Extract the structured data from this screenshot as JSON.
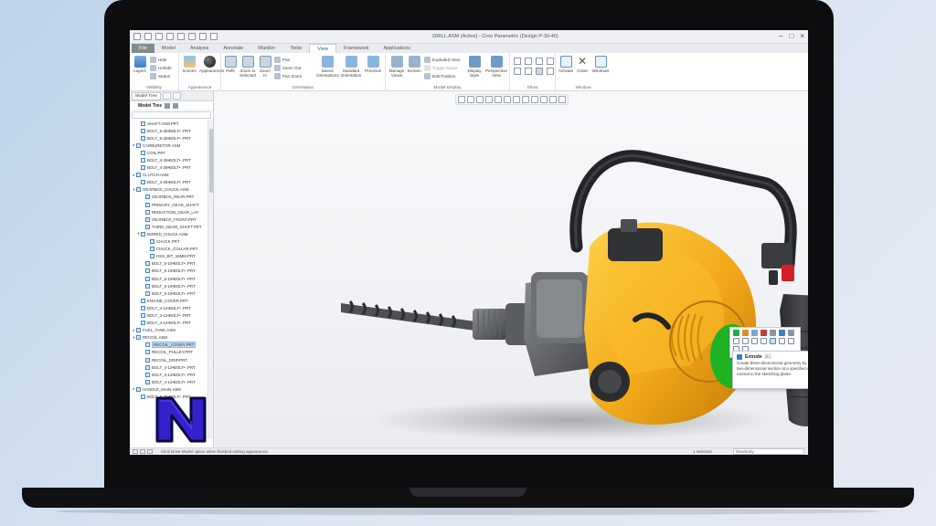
{
  "window": {
    "title": "DRILL.ASM (Active) - Creo Parametric (Design P-30-40)"
  },
  "tabs": [
    {
      "label": "File",
      "active": false
    },
    {
      "label": "Model",
      "active": false
    },
    {
      "label": "Analysis",
      "active": false
    },
    {
      "label": "Annotate",
      "active": false
    },
    {
      "label": "Manikin",
      "active": false
    },
    {
      "label": "Tools",
      "active": false
    },
    {
      "label": "View",
      "active": true
    },
    {
      "label": "Framework",
      "active": false
    },
    {
      "label": "Applications",
      "active": false
    }
  ],
  "ribbon": {
    "groups": [
      "Visibility",
      "Appearance",
      "Orientation",
      "Model Display",
      "Show",
      "Window"
    ],
    "buttons": {
      "layers": "Layers",
      "hide": "Hide",
      "unhide": "Unhide",
      "status": "Status",
      "scenes": "Scenes",
      "appearances": "Appearances",
      "refit": "Refit",
      "zoom_to_selected": "Zoom to Selected",
      "zoom_in": "Zoom In",
      "zoom_out": "Zoom Out",
      "pan": "Pan",
      "pan_zoom": "Pan Zoom",
      "saved_orientations": "Saved Orientations",
      "standard_orientation": "Standard Orientation",
      "previous": "Previous",
      "manage_views": "Manage Views",
      "section": "Section",
      "exploded_view": "Exploded View",
      "toggle_status": "Toggle Status",
      "edit_position": "Edit Position",
      "display_style": "Display Style",
      "perspective_view": "Perspective View",
      "activate": "Activate",
      "close": "Close",
      "windows": "Windows"
    }
  },
  "panel": {
    "tab_model_tree": "Model Tree",
    "header": "Model Tree"
  },
  "tree": [
    {
      "indent": 1,
      "expander": "",
      "label": "SHAFT.ASM.PRT",
      "selected": false
    },
    {
      "indent": 1,
      "expander": "",
      "label": "BOLT_5-30•BOLT• .PRT",
      "selected": false
    },
    {
      "indent": 1,
      "expander": "",
      "label": "BOLT_5-30•BOLT• .PRT",
      "selected": false
    },
    {
      "indent": 0,
      "expander": "▸",
      "label": "CARBURETOR.ASM",
      "selected": false
    },
    {
      "indent": 1,
      "expander": "",
      "label": "COIL.PRT",
      "selected": false
    },
    {
      "indent": 1,
      "expander": "",
      "label": "BOLT_4-30•BOLT• .PRT",
      "selected": false
    },
    {
      "indent": 1,
      "expander": "",
      "label": "BOLT_4-30•BOLT• .PRT",
      "selected": false
    },
    {
      "indent": 0,
      "expander": "▸",
      "label": "CLUTCH.ASM",
      "selected": false
    },
    {
      "indent": 1,
      "expander": "",
      "label": "BOLT_4-30•BOLT• .PRT",
      "selected": false
    },
    {
      "indent": 0,
      "expander": "▾",
      "label": "GEARBOX_CHUCK.ASM",
      "selected": false
    },
    {
      "indent": 2,
      "expander": "",
      "label": "GEARBOX_REAR.PRT",
      "selected": false
    },
    {
      "indent": 2,
      "expander": "",
      "label": "PRIMARY_GEAR_SHAFT",
      "selected": false
    },
    {
      "indent": 2,
      "expander": "",
      "label": "REDUCTION_GEAR_LAY",
      "selected": false
    },
    {
      "indent": 2,
      "expander": "",
      "label": "GEARBOX_FRONT.PRT",
      "selected": false
    },
    {
      "indent": 2,
      "expander": "",
      "label": "THIRD_GEAR_SHAFT.PRT",
      "selected": false
    },
    {
      "indent": 1,
      "expander": "▾",
      "label": "BORED_CHUCK.ASM",
      "selected": false
    },
    {
      "indent": 3,
      "expander": "",
      "label": "CHUCK.PRT",
      "selected": false
    },
    {
      "indent": 3,
      "expander": "",
      "label": "CHUCK_COLLAR.PRT",
      "selected": false
    },
    {
      "indent": 3,
      "expander": "",
      "label": "HSS_BIT_16MM.PRT",
      "selected": false
    },
    {
      "indent": 2,
      "expander": "",
      "label": "BOLT_5-10•BOLT• .PRT",
      "selected": false
    },
    {
      "indent": 2,
      "expander": "",
      "label": "BOLT_5-10•BOLT• .PRT",
      "selected": false
    },
    {
      "indent": 2,
      "expander": "",
      "label": "BOLT_5-10•BOLT• .PRT",
      "selected": false
    },
    {
      "indent": 2,
      "expander": "",
      "label": "BOLT_5-10•BOLT• .PRT",
      "selected": false
    },
    {
      "indent": 2,
      "expander": "",
      "label": "BOLT_5-10•BOLT• .PRT",
      "selected": false
    },
    {
      "indent": 1,
      "expander": "",
      "label": "ENGINE_COVER.PRT",
      "selected": false
    },
    {
      "indent": 1,
      "expander": "",
      "label": "BOLT_4-12•BOLT• .PRT",
      "selected": false
    },
    {
      "indent": 1,
      "expander": "",
      "label": "BOLT_4-12•BOLT• .PRT",
      "selected": false
    },
    {
      "indent": 1,
      "expander": "",
      "label": "BOLT_4-12•BOLT• .PRT",
      "selected": false
    },
    {
      "indent": 0,
      "expander": "▸",
      "label": "FUEL_TANK.ASM",
      "selected": false
    },
    {
      "indent": 0,
      "expander": "▾",
      "label": "RECOIL.ASM",
      "selected": false
    },
    {
      "indent": 2,
      "expander": "",
      "label": "RECOIL_COVER.PRT",
      "selected": true
    },
    {
      "indent": 2,
      "expander": "",
      "label": "RECOIL_PULLEY.PRT",
      "selected": false
    },
    {
      "indent": 2,
      "expander": "",
      "label": "RECOIL_GRIP.PRT",
      "selected": false
    },
    {
      "indent": 2,
      "expander": "",
      "label": "BOLT_4-12•BOLT• .PRT",
      "selected": false
    },
    {
      "indent": 2,
      "expander": "",
      "label": "BOLT_4-12•BOLT• .PRT",
      "selected": false
    },
    {
      "indent": 2,
      "expander": "",
      "label": "BOLT_4-12•BOLT• .PRT",
      "selected": false
    },
    {
      "indent": 0,
      "expander": "▸",
      "label": "HANDLE_MAIN.ASM",
      "selected": false
    },
    {
      "indent": 1,
      "expander": "",
      "label": "BOLT_6-20•BOLT• .PRT",
      "selected": false
    }
  ],
  "tooltip": {
    "title": "Extrude",
    "shortcut": "(E)",
    "body": "Create three-dimensional geometry by projecting a two-dimensional section at a specified distance normal to the sketching plane."
  },
  "status": {
    "message": "Click Drive Model option when finished editing appearance.",
    "selected": "1 selected",
    "filter": "Geometry"
  },
  "colors": {
    "engine_yellow": "#f2a81a",
    "highlight_green": "#1fb324",
    "logo_blue": "#3322cc",
    "accent_blue": "#0b62b5"
  },
  "icons": [
    "extrude-icon",
    "close-icon",
    "minimize-icon",
    "maximize-icon",
    "help-icon"
  ]
}
